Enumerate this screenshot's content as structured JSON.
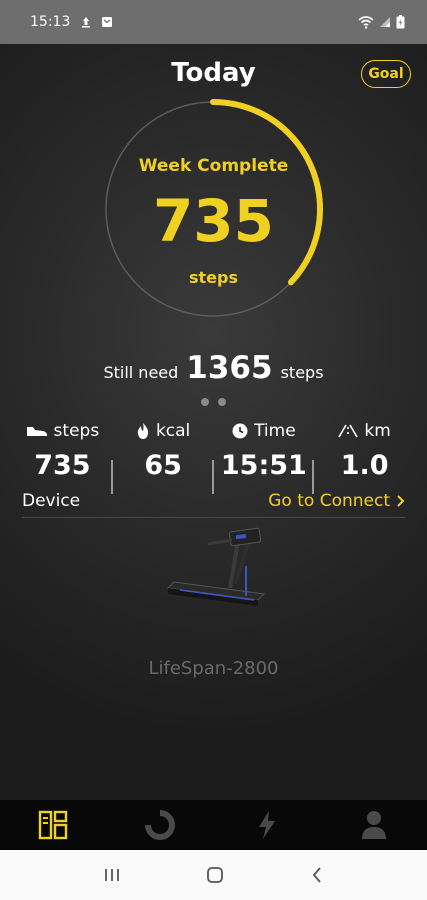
{
  "status_bar": {
    "time": "15:13"
  },
  "header": {
    "title": "Today",
    "goal_label": "Goal"
  },
  "progress": {
    "status": "Week Complete",
    "value": "735",
    "unit": "steps",
    "fraction": 0.37
  },
  "remaining": {
    "prefix": "Still need",
    "value": "1365",
    "suffix": "steps"
  },
  "pager": {
    "pages": 2
  },
  "stats": [
    {
      "icon": "shoe-icon",
      "label": "steps",
      "value": "735"
    },
    {
      "icon": "flame-icon",
      "label": "kcal",
      "value": "65"
    },
    {
      "icon": "clock-icon",
      "label": "Time",
      "value": "15:51"
    },
    {
      "icon": "road-icon",
      "label": "km",
      "value": "1.0"
    }
  ],
  "device": {
    "label": "Device",
    "link": "Go to Connect",
    "name": "LifeSpan-2800"
  },
  "tabs": [
    {
      "icon": "dashboard-icon",
      "active": true
    },
    {
      "icon": "activity-ring-icon",
      "active": false
    },
    {
      "icon": "lightning-icon",
      "active": false
    },
    {
      "icon": "profile-icon",
      "active": false
    }
  ],
  "colors": {
    "accent": "#f0d020",
    "background": "#1c1c1c",
    "tabbar": "#080808"
  }
}
